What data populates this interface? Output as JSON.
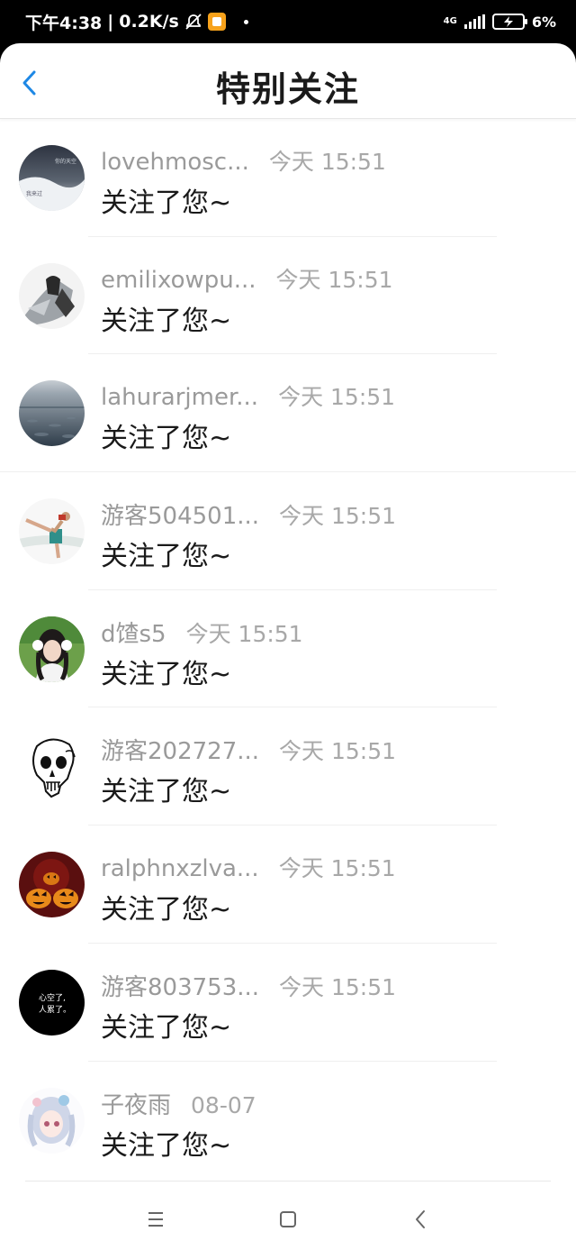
{
  "status": {
    "time": "下午4:38",
    "speed": "0.2K/s",
    "network": "4G",
    "battery": "6%"
  },
  "header": {
    "title": "特别关注"
  },
  "items": [
    {
      "name": "lovehmosc...",
      "time": "今天 15:51",
      "message": "关注了您~"
    },
    {
      "name": "emilixowpu...",
      "time": "今天 15:51",
      "message": "关注了您~"
    },
    {
      "name": "lahurarjmer...",
      "time": "今天 15:51",
      "message": "关注了您~"
    },
    {
      "name": "游客504501...",
      "time": "今天 15:51",
      "message": "关注了您~"
    },
    {
      "name": "d馇s5",
      "time": "今天 15:51",
      "message": "关注了您~"
    },
    {
      "name": "游客202727...",
      "time": "今天 15:51",
      "message": "关注了您~"
    },
    {
      "name": "ralphnxzlva...",
      "time": "今天 15:51",
      "message": "关注了您~"
    },
    {
      "name": "游客803753...",
      "time": "今天 15:51",
      "message": "关注了您~"
    },
    {
      "name": "子夜雨",
      "time": "08-07",
      "message": "关注了您~"
    }
  ],
  "avatar_texts": {
    "a1": "你的天空",
    "a1b": "我来过",
    "a8": "心空了,",
    "a8b": "人累了。"
  },
  "colors": {
    "accent": "#1e88e5",
    "name_gray": "#9a9a9a",
    "message_black": "#1a1a1a"
  }
}
